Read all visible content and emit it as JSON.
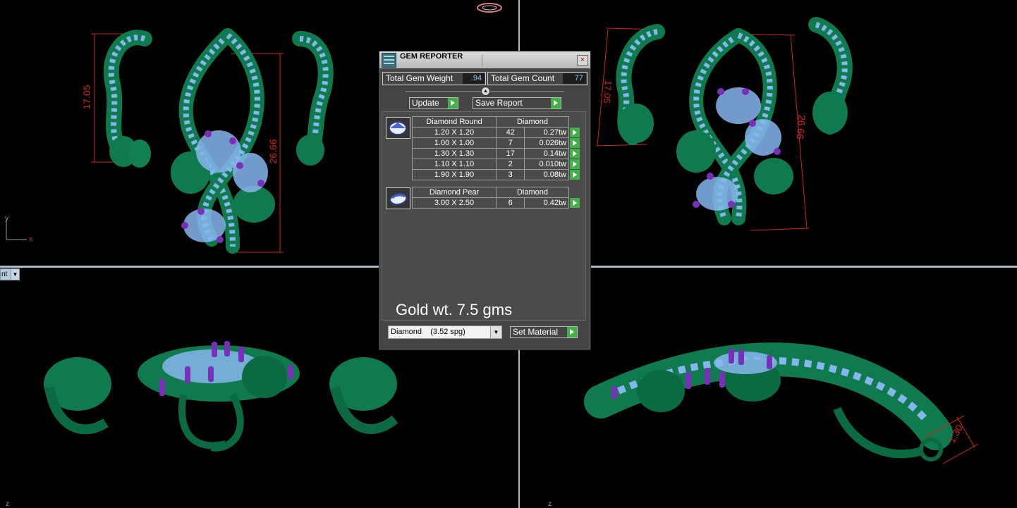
{
  "panel": {
    "title": "GEM REPORTER",
    "close_label": "×",
    "total_weight_label": "Total Gem Weight",
    "total_weight_value": ".94",
    "total_count_label": "Total Gem Count",
    "total_count_value": "77",
    "update_label": "Update",
    "save_report_label": "Save Report",
    "groups": [
      {
        "name": "Diamond Round",
        "material": "Diamond",
        "rows": [
          {
            "size": "1.20 X 1.20",
            "count": "42",
            "weight": "0.27tw"
          },
          {
            "size": "1.00 X 1.00",
            "count": "7",
            "weight": "0.026tw"
          },
          {
            "size": "1.30 X 1.30",
            "count": "17",
            "weight": "0.14tw"
          },
          {
            "size": "1.10 X 1.10",
            "count": "2",
            "weight": "0.010tw"
          },
          {
            "size": "1.90 X 1.90",
            "count": "3",
            "weight": "0.08tw"
          }
        ]
      },
      {
        "name": "Diamond Pear",
        "material": "Diamond",
        "rows": [
          {
            "size": "3.00 X 2.50",
            "count": "6",
            "weight": "0.42tw"
          }
        ]
      }
    ],
    "note": "Gold wt. 7.5 gms",
    "material_select_value": "Diamond    (3.52 spg)",
    "set_material_label": "Set Material"
  },
  "viewports": {
    "top_left": {
      "dim_a": "17.05",
      "dim_b": "26.66",
      "axis_y": "y",
      "axis_x": "x"
    },
    "top_right": {
      "dim_a": "17.05",
      "dim_b": "26.66"
    },
    "bottom_left": {
      "label": "nt",
      "axis_z": "z"
    },
    "bottom_right": {
      "dim_a": "1.30",
      "axis_z": "z"
    }
  },
  "colors": {
    "background": "#000000",
    "metal": "#0f7a4d",
    "gem_light": "#86b6ee",
    "gem_accent": "#7a2fb8",
    "dimension": "#d62020",
    "panel": "#454545",
    "go_button": "#3fb145"
  }
}
